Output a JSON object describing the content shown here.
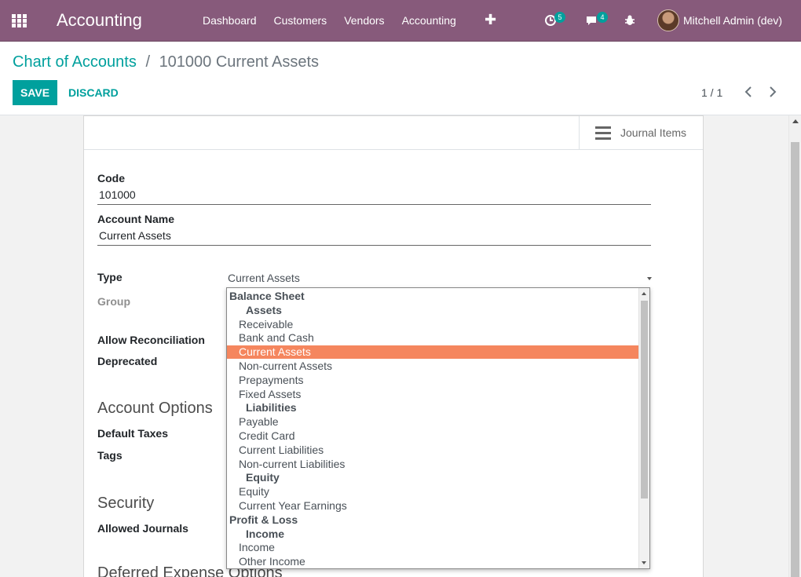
{
  "navbar": {
    "brand": "Accounting",
    "menu": [
      "Dashboard",
      "Customers",
      "Vendors",
      "Accounting"
    ],
    "plus_icon": "plus-icon",
    "activity_badge": "5",
    "messages_badge": "4",
    "debug_icon": "bug-icon",
    "user": "Mitchell Admin (dev)"
  },
  "breadcrumb": {
    "parent": "Chart of Accounts",
    "separator": "/",
    "current": "101000 Current Assets"
  },
  "actions": {
    "save": "SAVE",
    "discard": "DISCARD"
  },
  "pager": {
    "value": "1 / 1",
    "prev": "‹",
    "next": "›"
  },
  "stat_button": {
    "label": "Journal Items",
    "icon": "list-icon"
  },
  "form": {
    "code_label": "Code",
    "code_value": "101000",
    "name_label": "Account Name",
    "name_value": "Current Assets",
    "type_label": "Type",
    "type_value": "Current Assets",
    "group_label": "Group",
    "reconcile_label": "Allow Reconciliation",
    "deprecated_label": "Deprecated",
    "options_title": "Account Options",
    "taxes_label": "Default Taxes",
    "tags_label": "Tags",
    "security_title": "Security",
    "journals_label": "Allowed Journals",
    "deferred_title": "Deferred Expense Options"
  },
  "dropdown": {
    "items": [
      "Balance Sheet",
      "Assets",
      "Receivable",
      "Bank and Cash",
      "Current Assets",
      "Non-current Assets",
      "Prepayments",
      "Fixed Assets",
      "Liabilities",
      "Payable",
      "Credit Card",
      "Current Liabilities",
      "Non-current Liabilities",
      "Equity",
      "Equity",
      "Current Year Earnings",
      "Profit & Loss",
      "Income",
      "Income",
      "Other Income"
    ]
  },
  "colors": {
    "navbar": "#875a7b",
    "accent": "#00a09d",
    "selected_option": "#f5865e"
  }
}
